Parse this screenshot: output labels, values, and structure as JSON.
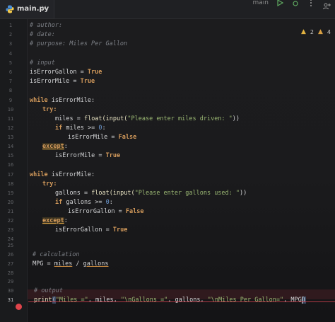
{
  "tab": {
    "filename": "main.py",
    "close": "×"
  },
  "toolbar": {
    "run_config": "main"
  },
  "inspection": {
    "warnings": "2",
    "weak_warnings": "4",
    "colors": {
      "warning": "#e3b341"
    }
  },
  "gutter": {
    "line_numbers": [
      "1",
      "2",
      "3",
      "4",
      "5",
      "6",
      "7",
      "8",
      "9",
      "10",
      "11",
      "12",
      "13",
      "14",
      "15",
      "16",
      "17",
      "18",
      "19",
      "20",
      "21",
      "22",
      "23",
      "24",
      "25",
      "26",
      "27",
      "28",
      "29",
      "30",
      "31"
    ],
    "current_line": "31"
  },
  "code": {
    "l1": "# author:",
    "l2": "# date:",
    "l3": "# purpose: Miles Per Gallon",
    "l5": "# input",
    "l6_var": "isErrorGallon",
    "l6_op": " = ",
    "l6_val": "True",
    "l7_var": "isErrorMile",
    "l7_op": " = ",
    "l7_val": "True",
    "l9_kw": "while ",
    "l9_rest": "isErrorMile:",
    "l10_kw": "try:",
    "l11_a": "miles = ",
    "l11_fn": "float(input(",
    "l11_str": "\"Please enter miles driven: \"",
    "l11_end": "))",
    "l12_kw": "if ",
    "l12_a": "miles >= ",
    "l12_num": "0",
    "l12_end": ":",
    "l13_a": "isErrorMile = ",
    "l13_val": "False",
    "l14_kw": "except",
    "l14_end": ":",
    "l15_a": "isErrorMile = ",
    "l15_val": "True",
    "l17_kw": "while ",
    "l17_rest": "isErrorMile:",
    "l18_kw": "try:",
    "l19_a": "gallons = ",
    "l19_fn": "float(input(",
    "l19_str": "\"Please enter gallons used: \"",
    "l19_end": "))",
    "l20_kw": "if ",
    "l20_a": "gallons >= ",
    "l20_num": "0",
    "l20_end": ":",
    "l21_a": "isErrorGallon = ",
    "l21_val": "False",
    "l22_kw": "except",
    "l22_end": ":",
    "l23_a": "isErrorGallon = ",
    "l23_val": "True",
    "l26": "# calculation",
    "l27_a": "MPG = ",
    "l27_b": "miles",
    "l27_c": " / ",
    "l27_d": "gallons",
    "l30": "# output",
    "l31_fn": "print",
    "l31_p": "(",
    "l31_s1": "\"Miles =\"",
    "l31_a": ", miles, ",
    "l31_s2": "\"\\nGallons =\"",
    "l31_b": ", gallons, ",
    "l31_s3": "\"\\nMiles Per Gallon=\"",
    "l31_c": ", MPG",
    "l31_p2": ")"
  }
}
